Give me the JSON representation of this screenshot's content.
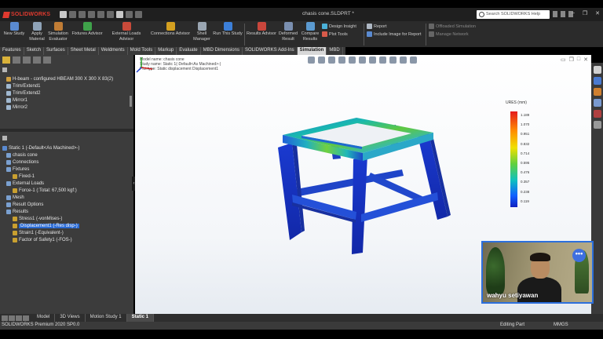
{
  "titlebar": {
    "brand": "SOLIDWORKS",
    "document_title": "chasis cone.SLDPRT *",
    "search_placeholder": "Search SOLIDWORKS Help"
  },
  "command_manager": {
    "buttons": [
      {
        "label": "New Study",
        "icon": "new-study-icon"
      },
      {
        "label": "Apply Material",
        "icon": "apply-material-icon"
      },
      {
        "label": "Simulation Evaluator",
        "icon": "simulation-evaluator-icon"
      },
      {
        "label": "Fixtures Advisor",
        "icon": "fixtures-advisor-icon"
      },
      {
        "label": "External Loads Advisor",
        "icon": "external-loads-icon"
      },
      {
        "label": "Connections Advisor",
        "icon": "connections-advisor-icon"
      },
      {
        "label": "Shell Manager",
        "icon": "shell-manager-icon"
      },
      {
        "label": "Run This Study",
        "icon": "run-study-icon"
      },
      {
        "label": "Results Advisor",
        "icon": "results-advisor-icon"
      },
      {
        "label": "Deformed Result",
        "icon": "deformed-result-icon"
      },
      {
        "label": "Compare Results",
        "icon": "compare-results-icon"
      }
    ],
    "small_items": [
      "Design Insight",
      "Plot Tools",
      "Report",
      "Include Image for Report",
      "Offloaded Simulation",
      "Manage Network"
    ]
  },
  "tabs": [
    "Features",
    "Sketch",
    "Surfaces",
    "Sheet Metal",
    "Weldments",
    "Mold Tools",
    "Markup",
    "Evaluate",
    "MBD Dimensions",
    "SOLIDWORKS Add-Ins",
    "Simulation",
    "MBD"
  ],
  "active_tab": "Simulation",
  "feature_tree": [
    "H-beam - configured HBEAM 300 X 300 X 83(2)",
    "Trim/Extend1",
    "Trim/Extend2",
    "Mirror1",
    "Mirror2"
  ],
  "study_tree": {
    "study": "Static 1 (-Default<As Machined>-)",
    "items": [
      {
        "label": "chasis cone",
        "indent": 1
      },
      {
        "label": "Connections",
        "indent": 1
      },
      {
        "label": "Fixtures",
        "indent": 1
      },
      {
        "label": "Fixed-1",
        "indent": 2
      },
      {
        "label": "External Loads",
        "indent": 1
      },
      {
        "label": "Force-1 (:Total: 67,500 kgf:)",
        "indent": 2
      },
      {
        "label": "Mesh",
        "indent": 1
      },
      {
        "label": "Result Options",
        "indent": 1
      },
      {
        "label": "Results",
        "indent": 1
      },
      {
        "label": "Stress1 (-vonMises-)",
        "indent": 2
      },
      {
        "label": "Displacement1 (-Res disp-)",
        "indent": 2,
        "selected": true
      },
      {
        "label": "Strain1 (-Equivalent-)",
        "indent": 2
      },
      {
        "label": "Factor of Safety1 (-FOS-)",
        "indent": 2
      }
    ]
  },
  "viewport": {
    "info_lines": [
      "Model name: chasis cone",
      "Study name: Static 1(-Default<As Machined>-)",
      "Plot type: Static displacement Displacement1"
    ],
    "legend_title": "URES (mm)",
    "legend_values": [
      "1.189",
      "1.070",
      "0.951",
      "0.832",
      "0.714",
      "0.595",
      "0.476",
      "0.357",
      "0.238",
      "0.119",
      "0.000"
    ]
  },
  "webcam": {
    "name": "wahyu setiyawan",
    "more_label": "•••"
  },
  "bottom_tabs": [
    "Model",
    "3D Views",
    "Motion Study 1",
    "Static 1"
  ],
  "active_bottom_tab": "Static 1",
  "statusbar": {
    "product": "SOLIDWORKS Premium 2020 SP0.0",
    "mode": "Editing Part",
    "units": "MMGS"
  }
}
